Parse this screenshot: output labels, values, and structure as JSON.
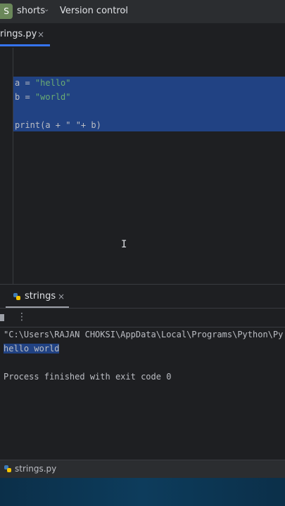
{
  "topbar": {
    "project_initial": "S",
    "project_name": "shorts",
    "vcs_label": "Version control"
  },
  "editor_tab": {
    "label": "rings.py",
    "close": "×"
  },
  "code_lines": [
    {
      "var": "a",
      "op": " = ",
      "str": "\"hello\""
    },
    {
      "var": "b",
      "op": " = ",
      "str": "\"world\""
    }
  ],
  "print_line": "print(a + \" \"+ b)",
  "run_tab": {
    "label": "strings",
    "close": "×"
  },
  "console": {
    "command": "\"C:\\Users\\RAJAN CHOKSI\\AppData\\Local\\Programs\\Python\\Py",
    "output": "hello world",
    "exit": "Process finished with exit code 0"
  },
  "statusbar": {
    "file": "strings.py"
  },
  "colors": {
    "accent": "#3574f0",
    "selection": "#214283",
    "string": "#6aab73"
  }
}
